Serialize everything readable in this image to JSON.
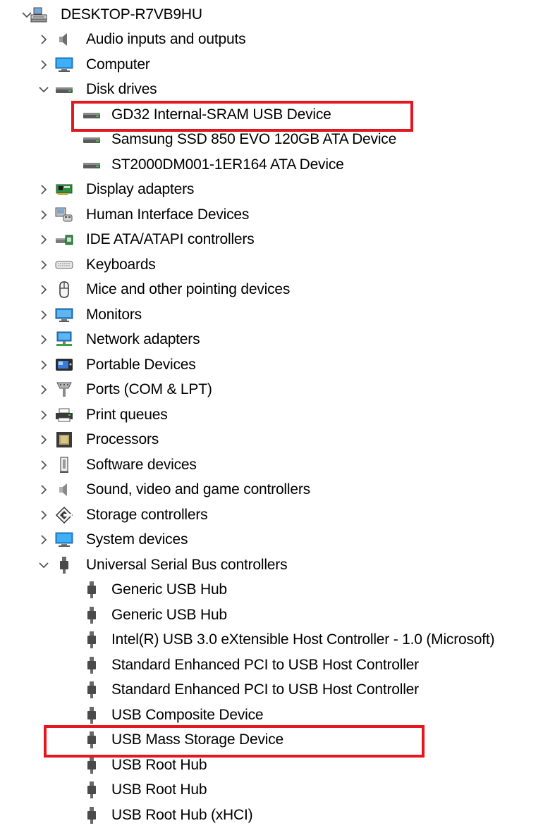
{
  "root": {
    "label": "DESKTOP-R7VB9HU",
    "expanded": true,
    "icon": "computer-network-icon"
  },
  "categories": [
    {
      "label": "Audio inputs and outputs",
      "icon": "speaker-icon",
      "expanded": false
    },
    {
      "label": "Computer",
      "icon": "monitor-icon",
      "expanded": false
    },
    {
      "label": "Disk drives",
      "icon": "disk-drive-icon",
      "expanded": true
    },
    {
      "label": "Display adapters",
      "icon": "display-adapter-icon",
      "expanded": false
    },
    {
      "label": "Human Interface Devices",
      "icon": "hid-icon",
      "expanded": false
    },
    {
      "label": "IDE ATA/ATAPI controllers",
      "icon": "ide-controller-icon",
      "expanded": false
    },
    {
      "label": "Keyboards",
      "icon": "keyboard-icon",
      "expanded": false
    },
    {
      "label": "Mice and other pointing devices",
      "icon": "mouse-icon",
      "expanded": false
    },
    {
      "label": "Monitors",
      "icon": "monitor-icon",
      "expanded": false
    },
    {
      "label": "Network adapters",
      "icon": "network-adapter-icon",
      "expanded": false
    },
    {
      "label": "Portable Devices",
      "icon": "portable-device-icon",
      "expanded": false
    },
    {
      "label": "Ports (COM & LPT)",
      "icon": "port-icon",
      "expanded": false
    },
    {
      "label": "Print queues",
      "icon": "printer-icon",
      "expanded": false
    },
    {
      "label": "Processors",
      "icon": "processor-icon",
      "expanded": false
    },
    {
      "label": "Software devices",
      "icon": "software-device-icon",
      "expanded": false
    },
    {
      "label": "Sound, video and game controllers",
      "icon": "speaker-icon",
      "expanded": false
    },
    {
      "label": "Storage controllers",
      "icon": "storage-controller-icon",
      "expanded": false
    },
    {
      "label": "System devices",
      "icon": "monitor-icon",
      "expanded": false
    },
    {
      "label": "Universal Serial Bus controllers",
      "icon": "usb-plug-icon",
      "expanded": true
    }
  ],
  "disk_drives": [
    {
      "label": "GD32 Internal-SRAM USB Device",
      "highlighted": true
    },
    {
      "label": "Samsung SSD 850 EVO 120GB ATA Device",
      "highlighted": false
    },
    {
      "label": "ST2000DM001-1ER164 ATA Device",
      "highlighted": false
    }
  ],
  "usb_controllers": [
    {
      "label": "Generic USB Hub",
      "highlighted": false
    },
    {
      "label": "Generic USB Hub",
      "highlighted": false
    },
    {
      "label": "Intel(R) USB 3.0 eXtensible Host Controller - 1.0 (Microsoft)",
      "highlighted": false
    },
    {
      "label": "Standard Enhanced PCI to USB Host Controller",
      "highlighted": false
    },
    {
      "label": "Standard Enhanced PCI to USB Host Controller",
      "highlighted": false
    },
    {
      "label": "USB Composite Device",
      "highlighted": false
    },
    {
      "label": "USB Mass Storage Device",
      "highlighted": true
    },
    {
      "label": "USB Root Hub",
      "highlighted": false
    },
    {
      "label": "USB Root Hub",
      "highlighted": false
    },
    {
      "label": "USB Root Hub (xHCI)",
      "highlighted": false
    }
  ],
  "colors": {
    "highlight_border": "#e4161f",
    "chevron": "#555555",
    "text": "#000000",
    "background": "#ffffff"
  }
}
